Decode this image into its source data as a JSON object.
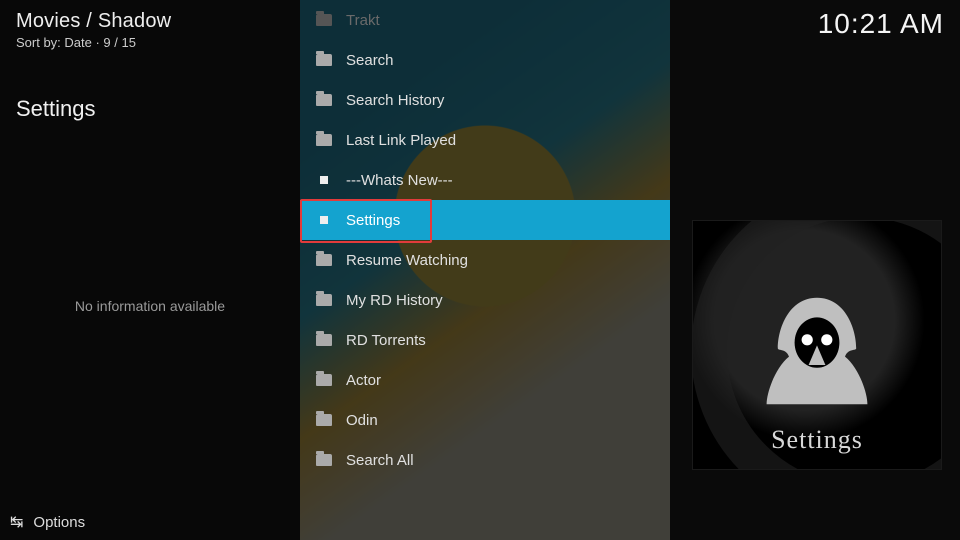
{
  "header": {
    "breadcrumb": "Movies / Shadow",
    "sortline": "Sort by: Date  ·  9 / 15",
    "clock": "10:21 AM"
  },
  "page": {
    "title": "Settings",
    "noinfo": "No information available"
  },
  "thumb": {
    "label": "Settings"
  },
  "footer": {
    "options_label": "Options"
  },
  "list": {
    "items": [
      {
        "label": "Trakt",
        "icon": "folder",
        "disabled": true
      },
      {
        "label": "Search",
        "icon": "folder"
      },
      {
        "label": "Search History",
        "icon": "folder"
      },
      {
        "label": "Last Link Played",
        "icon": "folder"
      },
      {
        "label": "---Whats New---",
        "icon": "bullet"
      },
      {
        "label": "Settings",
        "icon": "bullet",
        "selected": true
      },
      {
        "label": "Resume Watching",
        "icon": "folder"
      },
      {
        "label": "My RD History",
        "icon": "folder"
      },
      {
        "label": "RD Torrents",
        "icon": "folder"
      },
      {
        "label": "Actor",
        "icon": "folder"
      },
      {
        "label": "Odin",
        "icon": "folder"
      },
      {
        "label": "Search All",
        "icon": "folder"
      }
    ]
  }
}
